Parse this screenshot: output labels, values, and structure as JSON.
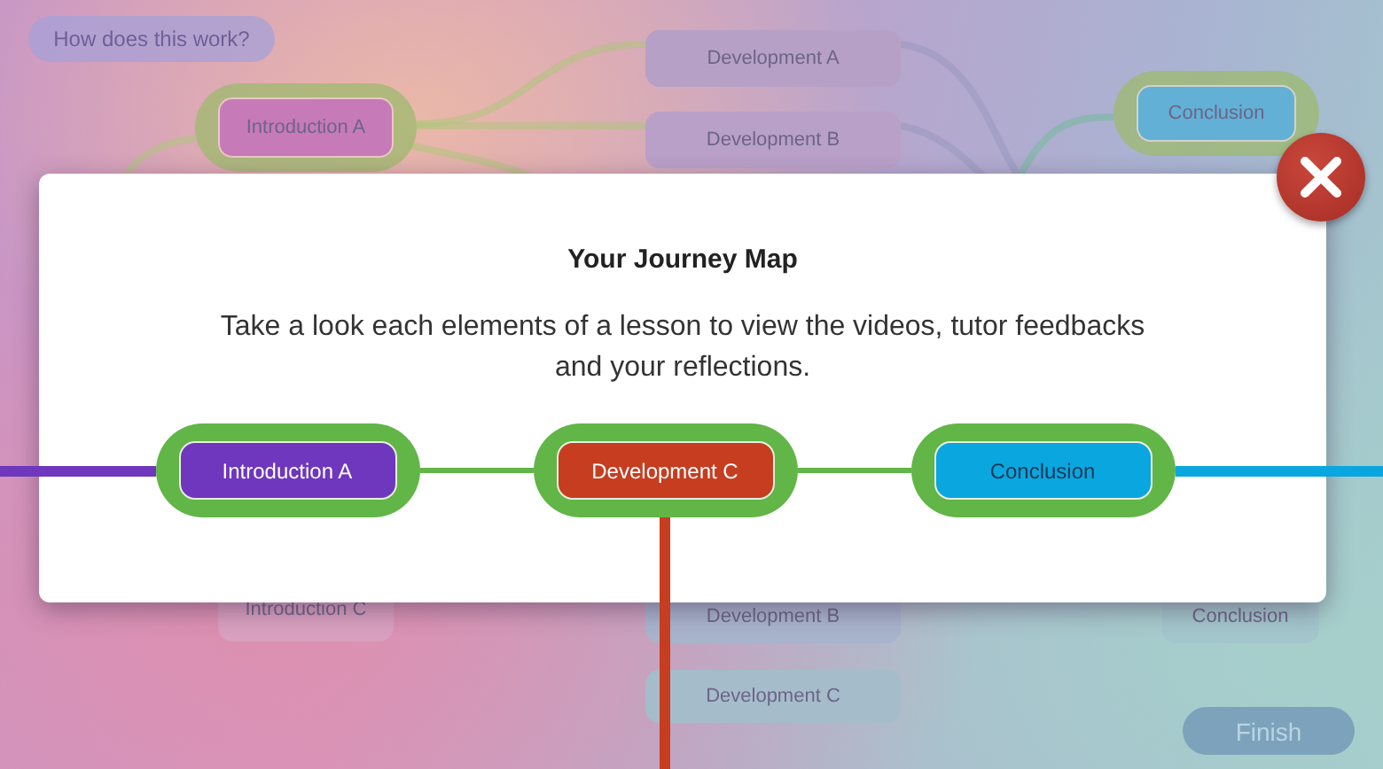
{
  "help_button": {
    "label": "How does this work?"
  },
  "map_nodes": [
    {
      "label": "Introduction A",
      "color": "#c77ab8",
      "ringed": true
    },
    {
      "label": "Development A",
      "color": "#b7a0c6",
      "ringed": false
    },
    {
      "label": "Development B",
      "color": "#b9a0c8",
      "ringed": false
    },
    {
      "label": "Conclusion",
      "color": "#62b0d6",
      "ringed": true
    },
    {
      "label": "Introduction C",
      "color": "#d9a0bf",
      "ringed": false
    },
    {
      "label": "Development B",
      "color": "#a8b3cc",
      "ringed": false
    },
    {
      "label": "Development C",
      "color": "#a5bccb",
      "ringed": false
    },
    {
      "label": "Conclusion",
      "color": "#a3c6cc",
      "ringed": false
    }
  ],
  "finish_button": {
    "label": "Finish"
  },
  "modal": {
    "title": "Your Journey Map",
    "description": "Take a look each elements of a lesson to view the videos, tutor feedbacks and your reflections.",
    "journey": [
      {
        "label": "Introduction A",
        "color": "#6e37bd",
        "selected": false
      },
      {
        "label": "Development C",
        "color": "#c63d20",
        "selected": true
      },
      {
        "label": "Conclusion",
        "color": "#0aa6e0",
        "selected": false
      }
    ]
  }
}
